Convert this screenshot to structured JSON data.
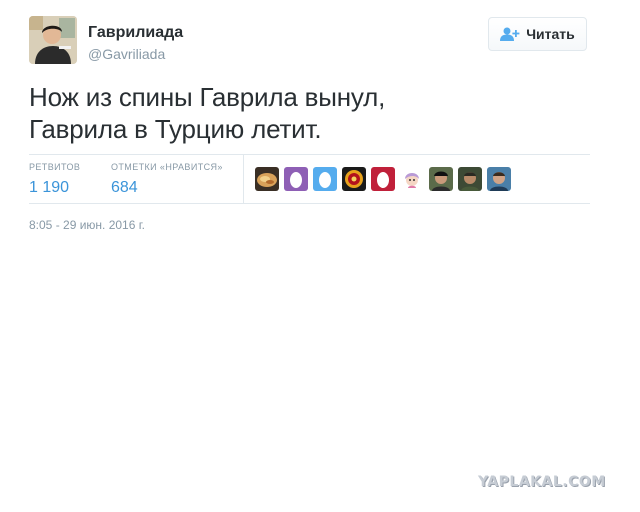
{
  "author": {
    "display_name": "Гаврилиада",
    "handle": "@Gavriliada",
    "avatar_icon": "user-avatar"
  },
  "follow_button": {
    "label": "Читать",
    "icon": "follow-user-icon",
    "icon_color": "#55acee"
  },
  "tweet": {
    "lines": [
      "Нож из спины Гаврила вынул,",
      "Гаврила в Турцию летит."
    ]
  },
  "stats": {
    "retweets_label": "РЕТВИТОВ",
    "retweets_value": "1 190",
    "likes_label": "ОТМЕТКИ «НРАВИТСЯ»",
    "likes_value": "684",
    "value_color": "#3b94d9",
    "likers": [
      {
        "icon": "food-photo-avatar"
      },
      {
        "icon": "default-egg-avatar-purple",
        "color": "#8e5fb5"
      },
      {
        "icon": "default-egg-avatar-blue",
        "color": "#55acee"
      },
      {
        "icon": "emblem-avatar"
      },
      {
        "icon": "default-egg-avatar-red",
        "color": "#c0203a"
      },
      {
        "icon": "cartoon-girl-avatar"
      },
      {
        "icon": "person-photo-avatar"
      },
      {
        "icon": "person-photo-avatar"
      },
      {
        "icon": "person-photo-avatar"
      },
      {
        "icon": "person-photo-avatar"
      }
    ]
  },
  "timestamp": "8:05 - 29 июн. 2016 г.",
  "watermark": "YAPLAKAL.COM"
}
